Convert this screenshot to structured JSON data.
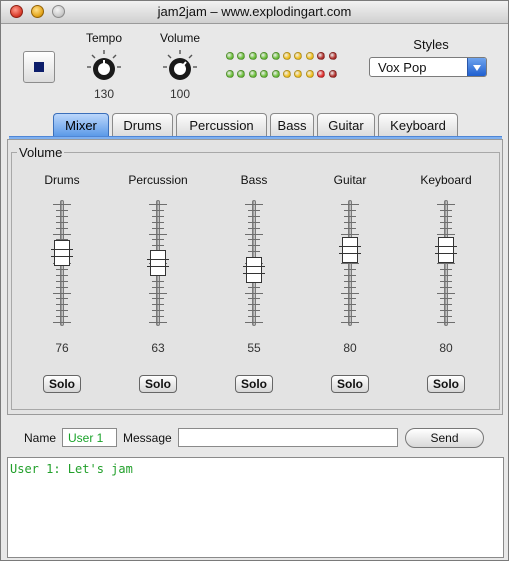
{
  "window": {
    "title": "jam2jam – www.explodingart.com"
  },
  "transport": {
    "stop_icon": "stop-icon"
  },
  "tempo": {
    "label": "Tempo",
    "value": "130"
  },
  "volume": {
    "label": "Volume",
    "value": "100"
  },
  "meter": {
    "rows": [
      [
        "#6bbf3a",
        "#6bbf3a",
        "#6bbf3a",
        "#6bbf3a",
        "#6bbf3a",
        "#f0c020",
        "#f0c020",
        "#f0c020",
        "#b0302c",
        "#b0302c"
      ],
      [
        "#6bbf3a",
        "#6bbf3a",
        "#6bbf3a",
        "#6bbf3a",
        "#6bbf3a",
        "#f0c020",
        "#f0c020",
        "#f0c020",
        "#e03030",
        "#b0302c"
      ]
    ]
  },
  "styles": {
    "label": "Styles",
    "selected": "Vox Pop"
  },
  "tabs": [
    {
      "label": "Mixer",
      "active": true
    },
    {
      "label": "Drums",
      "active": false
    },
    {
      "label": "Percussion",
      "active": false
    },
    {
      "label": "Bass",
      "active": false
    },
    {
      "label": "Guitar",
      "active": false
    },
    {
      "label": "Keyboard",
      "active": false
    }
  ],
  "mixer": {
    "group_title": "Volume",
    "solo_label": "Solo",
    "channels": [
      {
        "name": "Drums",
        "value": "76"
      },
      {
        "name": "Percussion",
        "value": "63"
      },
      {
        "name": "Bass",
        "value": "55"
      },
      {
        "name": "Guitar",
        "value": "80"
      },
      {
        "name": "Keyboard",
        "value": "80"
      }
    ]
  },
  "chat_bar": {
    "name_label": "Name",
    "name_value": "User 1",
    "message_label": "Message",
    "message_value": "",
    "send_label": "Send"
  },
  "chat_log": {
    "lines": [
      "User 1: Let's jam"
    ]
  }
}
